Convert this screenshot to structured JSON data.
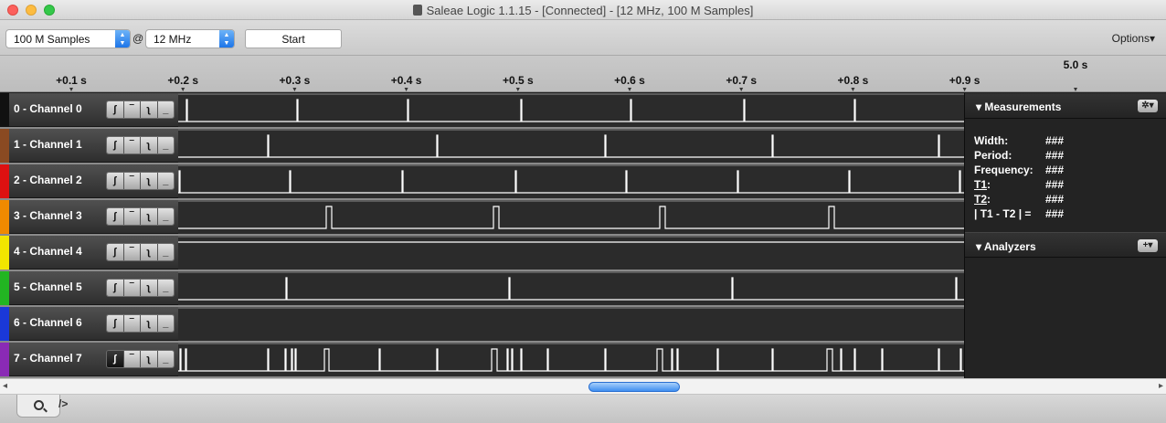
{
  "window": {
    "title": "Saleae Logic 1.1.15 - [Connected] - [12 MHz, 100 M Samples]"
  },
  "toolbar": {
    "samples": "100 M Samples",
    "at": "@",
    "rate": "12 MHz",
    "start_label": "Start",
    "options_label": "Options▾"
  },
  "ruler": {
    "ticks": [
      "+0.1 s",
      "+0.2 s",
      "+0.3 s",
      "+0.4 s",
      "+0.5 s",
      "+0.6 s",
      "+0.7 s",
      "+0.8 s",
      "+0.9 s"
    ],
    "total_label": "5.0 s"
  },
  "channels": [
    {
      "label": "0 - Channel 0",
      "color": "#111111"
    },
    {
      "label": "1 - Channel 1",
      "color": "#8a4a22"
    },
    {
      "label": "2 - Channel 2",
      "color": "#dd1111"
    },
    {
      "label": "3 - Channel 3",
      "color": "#f08a00"
    },
    {
      "label": "4 - Channel 4",
      "color": "#f2e600"
    },
    {
      "label": "5 - Channel 5",
      "color": "#22b522"
    },
    {
      "label": "6 - Channel 6",
      "color": "#1a38d8"
    },
    {
      "label": "7 - Channel 7",
      "color": "#8a2ab5"
    }
  ],
  "triggers": {
    "rising": "ʃ",
    "high": "‾",
    "falling": "ʅ",
    "low": "_"
  },
  "measurements": {
    "title": "Measurements",
    "gear": "✲▾",
    "width_label": "Width:",
    "width_value": "###",
    "period_label": "Period:",
    "period_value": "###",
    "frequency_label": "Frequency:",
    "frequency_value": "###",
    "t1_label": "T1",
    "t1_value": "###",
    "t2_label": "T2",
    "t2_value": "###",
    "diff_label": "| T1 - T2 | =",
    "diff_value": "###"
  },
  "analyzers": {
    "title": "Analyzers",
    "add": "+▾"
  },
  "scrollbar": {
    "left": "◂",
    "right": "▸"
  },
  "bottom": {
    "tab_arrow": "/>"
  }
}
